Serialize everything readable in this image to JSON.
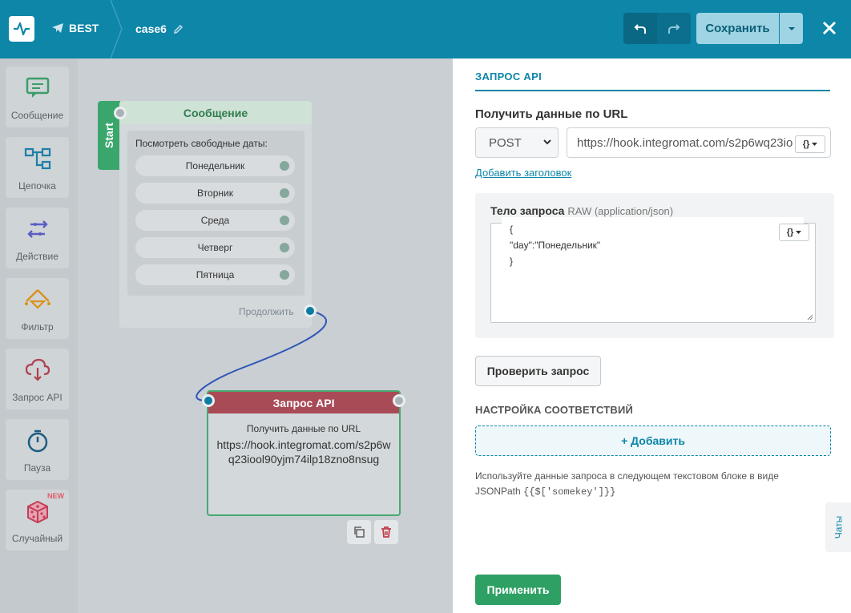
{
  "topbar": {
    "project": "BEST",
    "case_name": "case6",
    "save_label": "Сохранить"
  },
  "sidebar": {
    "items": [
      {
        "label": "Сообщение",
        "icon": "message-icon"
      },
      {
        "label": "Цепочка",
        "icon": "chain-icon"
      },
      {
        "label": "Действие",
        "icon": "action-icon"
      },
      {
        "label": "Фильтр",
        "icon": "filter-icon"
      },
      {
        "label": "Запрос API",
        "icon": "api-request-icon"
      },
      {
        "label": "Пауза",
        "icon": "pause-timer-icon"
      },
      {
        "label": "Случайный",
        "icon": "dice-icon",
        "badge": "NEW"
      }
    ]
  },
  "canvas": {
    "start_label": "Start",
    "message_node": {
      "title": "Сообщение",
      "text": "Посмотреть свободные даты:",
      "buttons": [
        "Понедельник",
        "Вторник",
        "Среда",
        "Четверг",
        "Пятница"
      ],
      "continue_label": "Продолжить"
    },
    "api_node": {
      "title": "Запрос API",
      "subtitle": "Получить данные по URL",
      "url": "https://hook.integromat.com/s2p6wq23iool90yjm74ilp18zno8nsug"
    }
  },
  "panel": {
    "tab": "ЗАПРОС API",
    "url_label": "Получить данные по URL",
    "method": "POST",
    "url_value": "https://hook.integromat.com/s2p6wq23io",
    "add_header": "Добавить заголовок",
    "body_title": "Тело запроса",
    "body_type": "RAW (application/json)",
    "body_lines": [
      "{",
      "\"day\":\"Понедельник\"",
      "}"
    ],
    "check_button": "Проверить запрос",
    "mapping_title": "НАСТРОЙКА СООТВЕТСТВИЙ",
    "add_button": "+ Добавить",
    "hint_text": "Используйте данные запроса в следующем текстовом блоке в виде JSONPath",
    "hint_code": "{{$['somekey']}}",
    "apply_button": "Применить",
    "chats_label": "Чаты"
  },
  "colors": {
    "brand": "#0d86a8",
    "start_green": "#3aa66c",
    "api_red": "#a94a57",
    "apply_green": "#2fa064"
  }
}
